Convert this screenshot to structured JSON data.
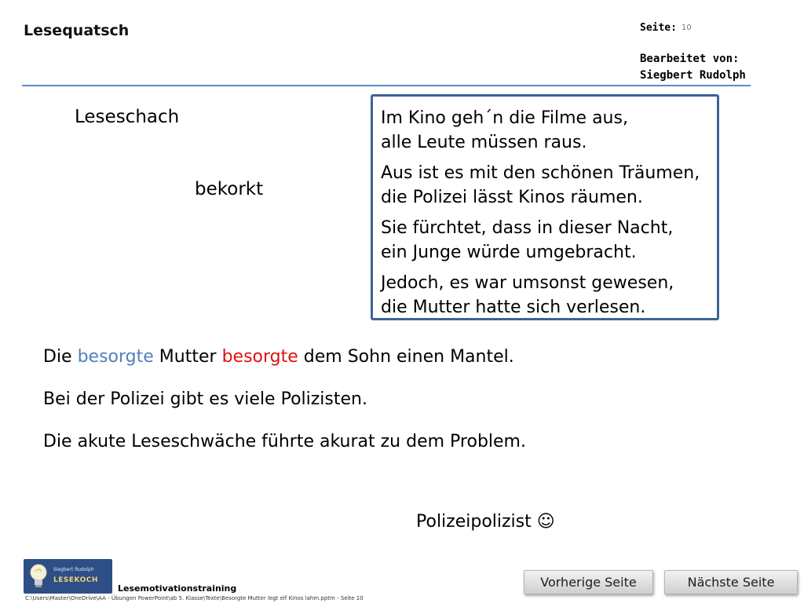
{
  "header": {
    "title": "Lesequatsch",
    "page_label": "Seite:",
    "page_number": "10",
    "editor_label": "Bearbeitet von:",
    "editor_name": "Siegbert Rudolph",
    "rule_color": "#5b8cc6"
  },
  "words": {
    "first": "Leseschach",
    "second": "bekorkt"
  },
  "poem": {
    "stanzas": [
      [
        "Im Kino geh´n die Filme aus,",
        "alle Leute müssen raus."
      ],
      [
        "Aus ist es mit den schönen Träumen,",
        "die Polizei lässt Kinos räumen."
      ],
      [
        "Sie fürchtet, dass in dieser Nacht,",
        "ein Junge würde umgebracht."
      ],
      [
        "Jedoch, es war umsonst gewesen,",
        "die Mutter hatte sich verlesen."
      ]
    ],
    "border_color": "#3d6494"
  },
  "sentences": {
    "s1": {
      "part1": "Die ",
      "word_blue": "besorgte",
      "part2": " Mutter ",
      "word_red": "besorgte",
      "part3": " dem Sohn einen Mantel.",
      "blue_color": "#4f81bd",
      "red_color": "#e01010"
    },
    "s2": "Bei der Polizei gibt es viele Polizisten.",
    "s3": "Die akute Leseschwäche führte akurat zu dem Problem."
  },
  "joke": "Polizeipolizist ☺",
  "footer": {
    "logo_line1": "Siegbert Rudolph",
    "logo_line2": "LESEKOCH",
    "label": "Lesemotivationstraining",
    "path": "C:\\Users\\Master\\OneDrive\\AA - Übungen PowerPoint\\ab 5. Klasse\\Texte\\Besorgte Mutter legt elf Kinos lahm.pptm - Seite 10"
  },
  "nav": {
    "prev_label": "Vorherige Seite",
    "next_label": "Nächste Seite"
  }
}
